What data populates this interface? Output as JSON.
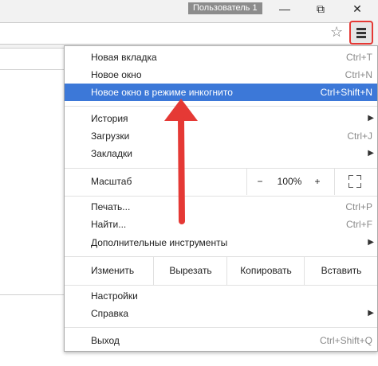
{
  "window": {
    "profile": "Пользователь 1",
    "minimize_glyph": "—",
    "restore_glyph": "⧉",
    "close_glyph": "✕"
  },
  "toolbar": {
    "star_glyph": "☆"
  },
  "menu": {
    "new_tab": {
      "label": "Новая вкладка",
      "accel": "Ctrl+T"
    },
    "new_window": {
      "label": "Новое окно",
      "accel": "Ctrl+N"
    },
    "incognito": {
      "label": "Новое окно в режиме инкогнито",
      "accel": "Ctrl+Shift+N"
    },
    "history": {
      "label": "История"
    },
    "downloads": {
      "label": "Загрузки",
      "accel": "Ctrl+J"
    },
    "bookmarks": {
      "label": "Закладки"
    },
    "zoom": {
      "label": "Масштаб",
      "minus": "−",
      "value": "100%",
      "plus": "+"
    },
    "print": {
      "label": "Печать...",
      "accel": "Ctrl+P"
    },
    "find": {
      "label": "Найти...",
      "accel": "Ctrl+F"
    },
    "more_tools": {
      "label": "Дополнительные инструменты"
    },
    "edit": {
      "label": "Изменить",
      "cut": "Вырезать",
      "copy": "Копировать",
      "paste": "Вставить"
    },
    "settings": {
      "label": "Настройки"
    },
    "help": {
      "label": "Справка"
    },
    "exit": {
      "label": "Выход",
      "accel": "Ctrl+Shift+Q"
    },
    "submenu_glyph": "▶"
  },
  "colors": {
    "highlight": "#3c78d8",
    "annotation_arrow": "#e53935"
  }
}
